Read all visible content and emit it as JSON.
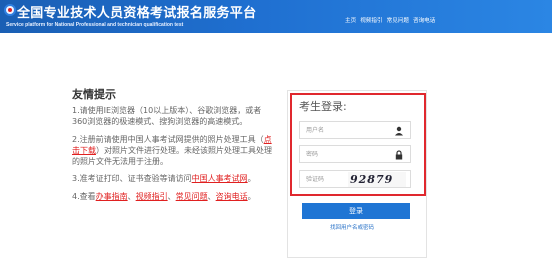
{
  "header": {
    "title": "全国专业技术人员资格考试报名服务平台",
    "subtitle": "Service platform for National Professional and technician qualification test",
    "nav": [
      "主页",
      "视频指引",
      "常见问题",
      "咨询电话"
    ]
  },
  "tips": {
    "title": "友情提示",
    "item1": "1.请使用IE浏览器（10以上版本）、谷歌浏览器，或者360浏览器的极速模式、搜狗浏览器的高速模式。",
    "item2_pre": "2.注册前请使用中国人事考试网提供的照片处理工具（",
    "item2_link": "点击下载",
    "item2_post": "）对照片文件进行处理。未经该照片处理工具处理的照片文件无法用于注册。",
    "item3_pre": "3.准考证打印、证书查验等请访问",
    "item3_link": "中国人事考试网",
    "item3_post": "。",
    "item4_pre": "4.查看",
    "item4_link1": "办事指南",
    "item4_link2": "视频指引",
    "item4_link3": "常见问题",
    "item4_link4": "咨询电话",
    "sep": "、",
    "end": "。"
  },
  "login": {
    "title": "考生登录:",
    "username_placeholder": "用户名",
    "password_placeholder": "密码",
    "captcha_placeholder": "验证码",
    "captcha_text": "92879",
    "button": "登录",
    "forgot": "找回用户名或密码"
  },
  "colors": {
    "header_blue": "#1f6fd0",
    "accent_red": "#e02020",
    "button_blue": "#1f75d4"
  }
}
